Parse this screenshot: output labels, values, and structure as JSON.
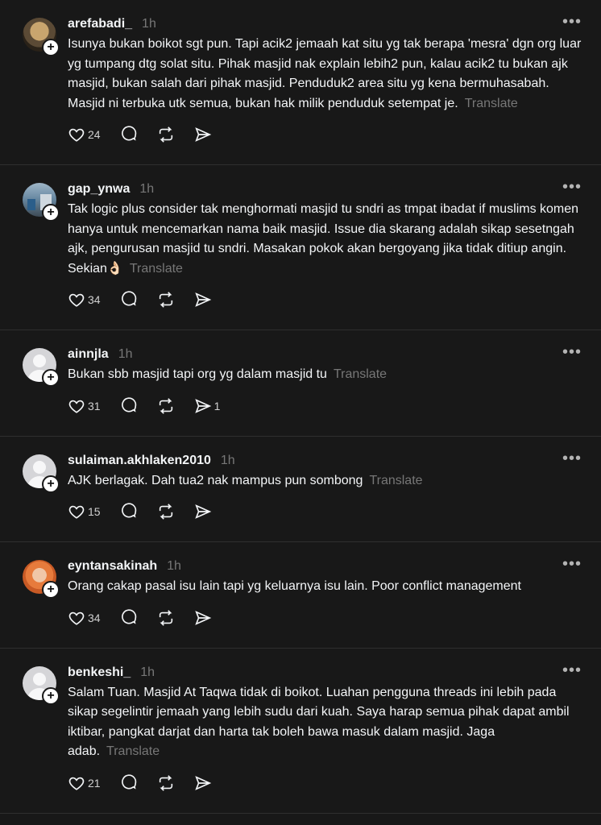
{
  "posts": [
    {
      "username": "arefabadi_",
      "time": "1h",
      "avatar": "photo1",
      "text": "Isunya bukan boikot sgt pun. Tapi acik2 jemaah kat situ yg tak berapa 'mesra' dgn org luar yg tumpang dtg solat situ. Pihak masjid nak explain lebih2 pun, kalau acik2 tu bukan ajk masjid, bukan salah dari pihak masjid. Penduduk2 area situ yg kena bermuhasabah. Masjid ni terbuka utk semua, bukan hak milik penduduk setempat je.",
      "translate": "Translate",
      "likes": "24",
      "shares": ""
    },
    {
      "username": "gap_ynwa",
      "time": "1h",
      "avatar": "photo2",
      "text": "Tak logic plus consider tak menghormati masjid tu sndri as tmpat ibadat if muslims komen hanya untuk mencemarkan nama baik masjid. Issue dia skarang adalah sikap sesetngah ajk, pengurusan masjid tu sndri. Masakan pokok akan bergoyang jika tidak ditiup angin. Sekian👌🏻",
      "translate": "Translate",
      "likes": "34",
      "shares": ""
    },
    {
      "username": "ainnjla",
      "time": "1h",
      "avatar": "default",
      "text": "Bukan sbb masjid tapi org yg dalam masjid tu",
      "translate": "Translate",
      "likes": "31",
      "shares": "1"
    },
    {
      "username": "sulaiman.akhlaken2010",
      "time": "1h",
      "avatar": "default",
      "text": "AJK berlagak. Dah tua2 nak mampus pun sombong",
      "translate": "Translate",
      "likes": "15",
      "shares": ""
    },
    {
      "username": "eyntansakinah",
      "time": "1h",
      "avatar": "photo3",
      "text": "Orang cakap pasal isu lain tapi yg keluarnya isu lain. Poor conflict management",
      "translate": "",
      "likes": "34",
      "shares": ""
    },
    {
      "username": "benkeshi_",
      "time": "1h",
      "avatar": "default",
      "text": "Salam Tuan. Masjid At Taqwa tidak di boikot. Luahan pengguna threads ini lebih pada sikap segelintir jemaah yang lebih sudu dari kuah. Saya harap semua pihak dapat ambil iktibar, pangkat darjat dan harta tak boleh bawa masuk dalam masjid. Jaga adab.",
      "translate": "Translate",
      "likes": "21",
      "shares": ""
    }
  ],
  "icons": {
    "more": "more-dots-icon",
    "like": "heart-icon",
    "reply": "comment-bubble-icon",
    "repost": "repost-icon",
    "share": "send-icon"
  }
}
